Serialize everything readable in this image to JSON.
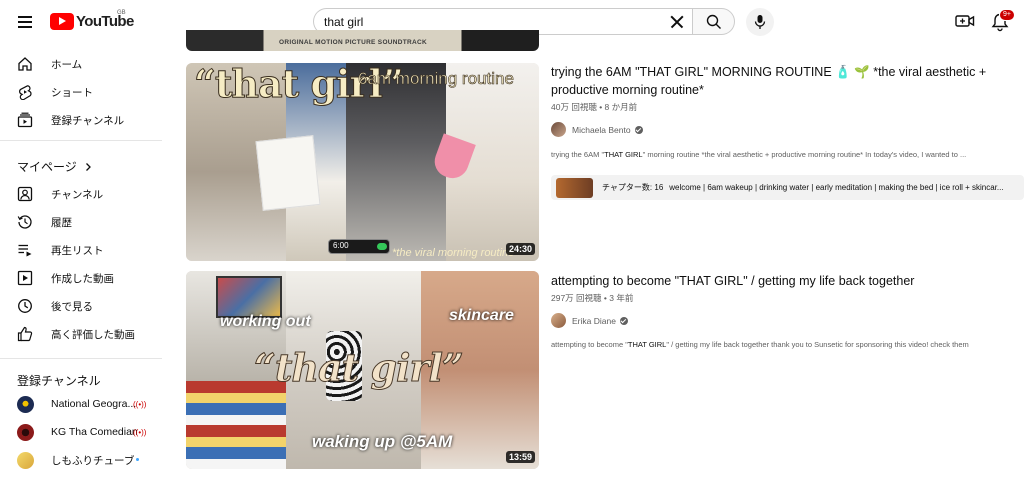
{
  "header": {
    "logo_text": "YouTube",
    "region": "GB",
    "search_value": "that girl",
    "notification_count": "9+"
  },
  "sidebar": {
    "main_items": [
      {
        "label": "ホーム",
        "icon": "home-icon"
      },
      {
        "label": "ショート",
        "icon": "shorts-icon"
      },
      {
        "label": "登録チャンネル",
        "icon": "subscriptions-icon"
      }
    ],
    "you_heading": "マイページ",
    "you_items": [
      {
        "label": "チャンネル",
        "icon": "your-channel-icon"
      },
      {
        "label": "履歴",
        "icon": "history-icon"
      },
      {
        "label": "再生リスト",
        "icon": "playlists-icon"
      },
      {
        "label": "作成した動画",
        "icon": "your-videos-icon"
      },
      {
        "label": "後で見る",
        "icon": "watch-later-icon"
      },
      {
        "label": "高く評価した動画",
        "icon": "liked-videos-icon"
      }
    ],
    "subs_heading": "登録チャンネル",
    "subscriptions": [
      {
        "name": "National Geogra...",
        "status": "live",
        "color": "#1c2b52"
      },
      {
        "name": "KG Tha Comedian",
        "status": "live",
        "color": "#8b1a1a"
      },
      {
        "name": "しもふりチューブ",
        "status": "new",
        "color": "#e8c24a"
      }
    ]
  },
  "top_thumb_caption": "ORIGINAL MOTION PICTURE SOUNDTRACK",
  "results": [
    {
      "title": "trying the 6AM \"THAT GIRL\" MORNING ROUTINE 🧴 🌱 *the viral aesthetic + productive morning routine*",
      "views": "40万 回視聴",
      "age": "8 か月前",
      "channel": "Michaela Bento",
      "desc_before": "trying the 6AM \"",
      "desc_bold": "THAT GIRL",
      "desc_after": "\" morning routine *the viral aesthetic + productive morning routine* In today's video, I wanted to ...",
      "duration": "24:30",
      "thumb_text_1": "“that girl”",
      "thumb_text_2": "6am morning routine",
      "thumb_text_3": "*the viral morning routine",
      "thumb_clock": "6:00",
      "chapters_label": "チャプター数: 16",
      "chapters_text": "welcome | 6am wakeup | drinking water | early meditation | making the bed | ice roll + skincar..."
    },
    {
      "title": "attempting to become \"THAT GIRL\" / getting my life back together",
      "views": "297万 回視聴",
      "age": "3 年前",
      "channel": "Erika Diane",
      "desc_before": "attempting to become \"",
      "desc_bold": "THAT GIRL",
      "desc_after": "\" / getting my life back together thank you to Sunsetic for sponsoring this video! check them",
      "duration": "13:59",
      "thumb_text_1": "working out",
      "thumb_text_2": "skincare",
      "thumb_text_3": "“that girl”",
      "thumb_text_4": "waking up @5AM"
    }
  ],
  "colors": {
    "brand_red": "#ff0000",
    "text_primary": "#0f0f0f",
    "text_secondary": "#606060",
    "live_red": "#cc0000"
  }
}
